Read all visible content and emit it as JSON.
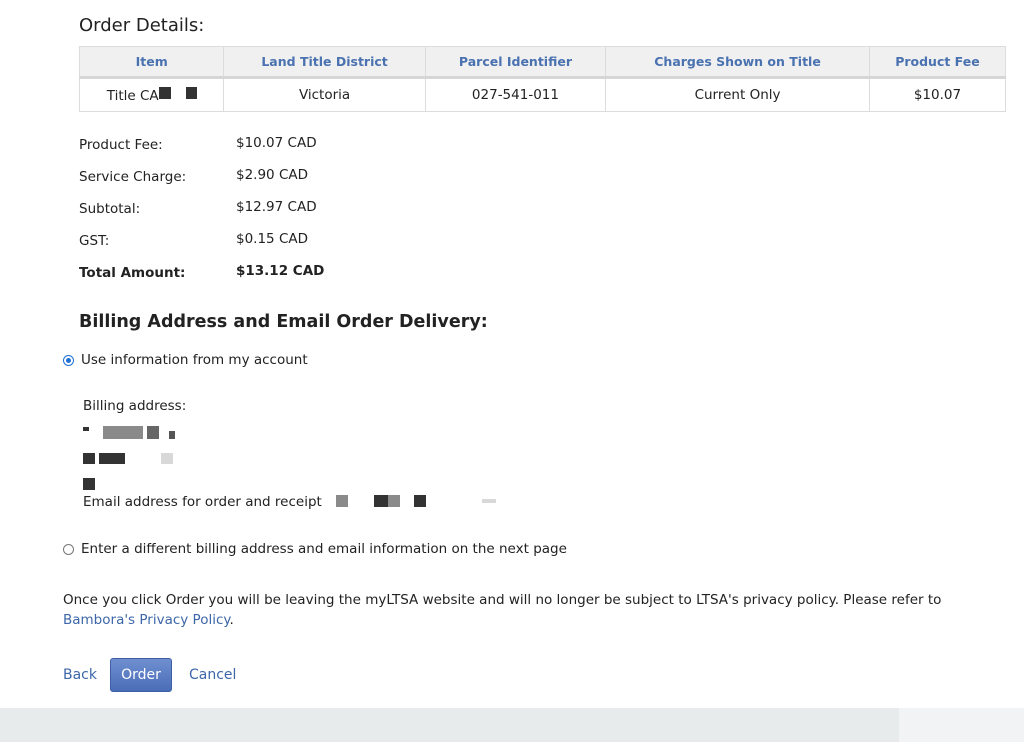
{
  "order": {
    "heading": "Order Details:",
    "columns": [
      "Item",
      "Land Title District",
      "Parcel Identifier",
      "Charges Shown on Title",
      "Product Fee"
    ],
    "row": {
      "item": "Title CA",
      "district": "Victoria",
      "pid": "027-541-011",
      "charges": "Current Only",
      "fee": "$10.07"
    }
  },
  "fees": [
    {
      "label": "Product Fee:",
      "value": "$10.07 CAD"
    },
    {
      "label": "Service Charge:",
      "value": "$2.90 CAD"
    },
    {
      "label": "Subtotal:",
      "value": "$12.97 CAD"
    },
    {
      "label": "GST:",
      "value": "$0.15 CAD"
    },
    {
      "label": "Total Amount:",
      "value": "$13.12 CAD"
    }
  ],
  "billing": {
    "heading": "Billing Address and Email Order Delivery:",
    "option_account": "Use information from my account",
    "address_label": "Billing address:",
    "email_label": "Email address for order and receipt",
    "option_different": "Enter a different billing address and email information on the next page"
  },
  "notice": {
    "text": "Once you click Order you will be leaving the myLTSA website and will no longer be subject to LTSA's privacy policy. Please refer to ",
    "link": "Bambora's Privacy Policy",
    "end": "."
  },
  "buttons": {
    "back": "Back",
    "order": "Order",
    "cancel": "Cancel"
  },
  "colors": {
    "link": "#3d67a8",
    "header_text": "#4a72b0",
    "radio_accent": "#1e6fd9",
    "button": "#4a6db8"
  }
}
